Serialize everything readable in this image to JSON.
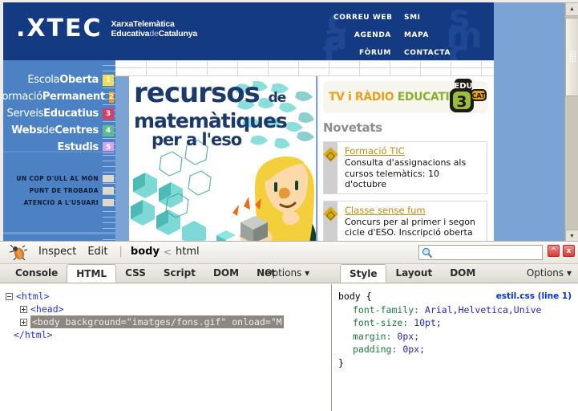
{
  "browser": {
    "site": {
      "logo_mark": ".XTEC",
      "logo_tagline_1a": "Xarxa",
      "logo_tagline_1b": "Telemàtica",
      "logo_tagline_2a": "Educativa",
      "logo_tagline_2b": "de",
      "logo_tagline_2c": "Catalunya",
      "watermarks": [
        "c",
        "a",
        "f",
        "s",
        "m",
        "c"
      ],
      "header_nav_left": [
        "CORREU WEB",
        "AGENDA",
        "FÒRUM"
      ],
      "header_nav_right": [
        "SMI",
        "MAPA",
        "CONTACTA"
      ],
      "sidebar": {
        "items": [
          {
            "light": "Escola",
            "bold": "Oberta",
            "num": "1",
            "color": "#f2dd57"
          },
          {
            "light": "Formació",
            "bold": "Permanent",
            "num": "2",
            "color": "#f59b1e"
          },
          {
            "light": "Serveis",
            "bold": "Educatius",
            "num": "3",
            "color": "#d83d63"
          },
          {
            "light": "Webs",
            "mid": "de",
            "bold": "Centres",
            "num": "4",
            "color": "#5cbd8e"
          },
          {
            "light": "",
            "bold": "Estudis",
            "num": "5",
            "color": "#d8a0f0"
          }
        ],
        "secondary": [
          "UN COP D'ULL AL MÓN",
          "PUNT DE TROBADA",
          "ATENCIÓ A L'USUARI"
        ]
      },
      "banner": {
        "line1": "recursos",
        "line1_small": "de",
        "line2": "matemàtiques",
        "line3": "per a l'eso"
      },
      "right_column": {
        "tv_banner_orange": "TV i RÀDIO",
        "tv_banner_green": "EDUCATIVES!",
        "edu3_edu": "EDU",
        "edu3_num": "3",
        "edu3_cat": "CAT",
        "section_title": "Novetats",
        "news": [
          {
            "title": "Formació TIC",
            "desc": "Consulta d'assignacions als cursos telemàtics: 10 d'octubre"
          },
          {
            "title": "Classe sense fum",
            "desc": "Concurs per al primer i segon cicle d'ESO. Inscripció oberta"
          }
        ]
      }
    }
  },
  "firebug": {
    "toolbar": {
      "inspect_label": "Inspect",
      "edit_label": "Edit",
      "divider": "|",
      "breadcrumb_current": "body",
      "breadcrumb_sep": "<",
      "breadcrumb_parent": "html",
      "search_value": "",
      "search_placeholder": "",
      "minimize_label": "^",
      "close_label": "x"
    },
    "left_tabs": [
      "Console",
      "HTML",
      "CSS",
      "Script",
      "DOM",
      "Net"
    ],
    "left_active_tab": "HTML",
    "left_options_label": "Options",
    "right_tabs": [
      "Style",
      "Layout",
      "DOM"
    ],
    "right_active_tab": "Style",
    "right_options_label": "Options",
    "html_tree": {
      "line_open": "<html>",
      "line_head": "<head>",
      "line_body_selected": "<body background=\"imatges/fons.gif\" onload=\"M",
      "line_close": "</html>"
    },
    "style_panel": {
      "selector": "body {",
      "source": "estil.css (line 1)",
      "declarations": [
        {
          "prop": "font-family:",
          "value": "Arial,Helvetica,Unive"
        },
        {
          "prop": "font-size:",
          "value": "10pt;"
        },
        {
          "prop": "margin:",
          "value": "0px;"
        },
        {
          "prop": "padding:",
          "value": "0px;"
        }
      ],
      "close_brace": "}"
    }
  }
}
